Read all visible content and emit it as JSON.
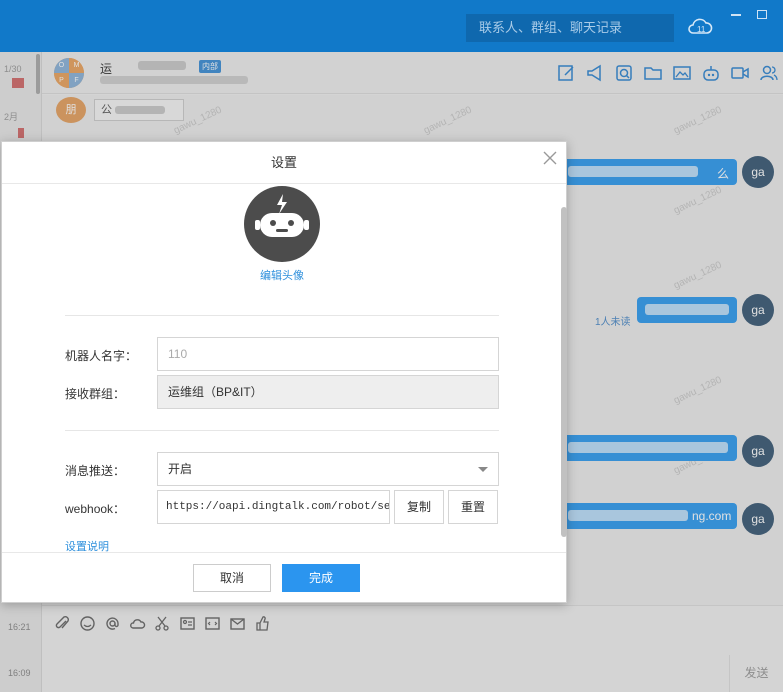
{
  "app": {
    "search_placeholder": "联系人、群组、聊天记录"
  },
  "left_list": {
    "times": [
      "1/30",
      "2月",
      "16:21",
      "16:09"
    ]
  },
  "chat": {
    "group_name": "运",
    "tag": "内部",
    "pinned_avatar": "朋",
    "pinned_label": "公",
    "watermark": "gawu_1280",
    "bubble_text_1": "么",
    "bubble_text_5": "ng.com",
    "my_avatar": "ga",
    "unread": "1人未读",
    "send_label": "发送"
  },
  "dialog": {
    "title": "设置",
    "edit_avatar": "编辑头像",
    "robot_name_label": "机器人名字：",
    "robot_name_value": "110",
    "group_label": "接收群组：",
    "group_value": "运维组（BP&IT）",
    "push_label": "消息推送：",
    "push_value": "开启",
    "webhook_label": "webhook：",
    "webhook_value": "https://oapi.dingtalk.com/robot/send?",
    "copy_label": "复制",
    "reset_label": "重置",
    "help_label": "设置说明",
    "cancel_label": "取消",
    "ok_label": "完成"
  },
  "colors": {
    "topbar": "#1179c9",
    "accent": "#2b95ef",
    "bubble": "#2f9bf0",
    "bot_avatar": "#4c4c4c"
  }
}
